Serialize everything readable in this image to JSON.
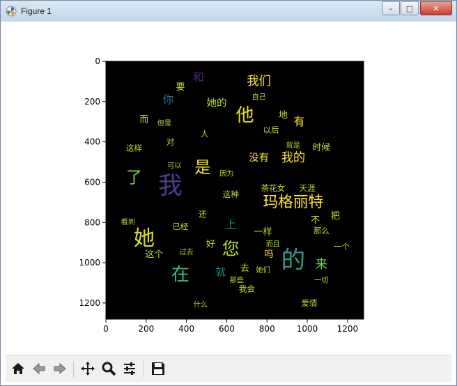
{
  "window": {
    "title": "Figure 1",
    "minimize_label": "–",
    "maximize_label": "□",
    "close_label": "✕"
  },
  "toolbar": {
    "icons": [
      "home-icon",
      "back-icon",
      "forward-icon",
      "pan-icon",
      "zoom-icon",
      "configure-subplots-icon",
      "save-icon"
    ]
  },
  "colors": {
    "plot_bg": "#000000",
    "axis": "#000000"
  },
  "chart_data": {
    "type": "image",
    "description_free": true,
    "xlim": [
      0,
      1280
    ],
    "ylim": [
      1280,
      0
    ],
    "xticks": [
      0,
      200,
      400,
      600,
      800,
      1000,
      1200
    ],
    "yticks": [
      0,
      200,
      400,
      600,
      800,
      1000,
      1200
    ],
    "xtick_labels": [
      "0",
      "200",
      "400",
      "600",
      "800",
      "1000",
      "1200"
    ],
    "ytick_labels": [
      "0",
      "200",
      "400",
      "600",
      "800",
      "1000",
      "1200"
    ],
    "words": [
      {
        "text": "我",
        "x": 320,
        "y": 620,
        "size": 120,
        "color": "#4b3d8f"
      },
      {
        "text": "的",
        "x": 930,
        "y": 990,
        "size": 120,
        "color": "#2a9c8a"
      },
      {
        "text": "她",
        "x": 190,
        "y": 880,
        "size": 105,
        "color": "#d8e219"
      },
      {
        "text": "他",
        "x": 690,
        "y": 270,
        "size": 90,
        "color": "#e5e419"
      },
      {
        "text": "在",
        "x": 370,
        "y": 1060,
        "size": 90,
        "color": "#3fbc73"
      },
      {
        "text": "您",
        "x": 620,
        "y": 930,
        "size": 85,
        "color": "#b5de2b"
      },
      {
        "text": "是",
        "x": 480,
        "y": 530,
        "size": 80,
        "color": "#fde725"
      },
      {
        "text": "了",
        "x": 140,
        "y": 580,
        "size": 80,
        "color": "#7ad151"
      },
      {
        "text": "玛格丽特",
        "x": 930,
        "y": 700,
        "size": 75,
        "color": "#fde725"
      },
      {
        "text": "我们",
        "x": 760,
        "y": 100,
        "size": 60,
        "color": "#fde725"
      },
      {
        "text": "我的",
        "x": 930,
        "y": 480,
        "size": 60,
        "color": "#fde725"
      },
      {
        "text": "来",
        "x": 1070,
        "y": 1010,
        "size": 60,
        "color": "#6ccd5a"
      },
      {
        "text": "和",
        "x": 460,
        "y": 80,
        "size": 55,
        "color": "#482878"
      },
      {
        "text": "没有",
        "x": 760,
        "y": 480,
        "size": 50,
        "color": "#fde725"
      },
      {
        "text": "你",
        "x": 310,
        "y": 190,
        "size": 55,
        "color": "#31688e"
      },
      {
        "text": "她的",
        "x": 550,
        "y": 210,
        "size": 50,
        "color": "#b5de2b"
      },
      {
        "text": "上",
        "x": 620,
        "y": 810,
        "size": 55,
        "color": "#26828e"
      },
      {
        "text": "有",
        "x": 960,
        "y": 300,
        "size": 55,
        "color": "#fde725"
      },
      {
        "text": "一样",
        "x": 780,
        "y": 850,
        "size": 45,
        "color": "#b5de2b"
      },
      {
        "text": "就",
        "x": 570,
        "y": 1050,
        "size": 50,
        "color": "#21918c"
      },
      {
        "text": "一个",
        "x": 1170,
        "y": 920,
        "size": 40,
        "color": "#b5de2b"
      },
      {
        "text": "时候",
        "x": 1070,
        "y": 430,
        "size": 45,
        "color": "#b5de2b"
      },
      {
        "text": "要",
        "x": 370,
        "y": 130,
        "size": 45,
        "color": "#b5de2b"
      },
      {
        "text": "这个",
        "x": 240,
        "y": 960,
        "size": 45,
        "color": "#b5de2b"
      },
      {
        "text": "这样",
        "x": 140,
        "y": 430,
        "size": 40,
        "color": "#b5de2b"
      },
      {
        "text": "茶花女",
        "x": 830,
        "y": 630,
        "size": 40,
        "color": "#b5de2b"
      },
      {
        "text": "已经",
        "x": 370,
        "y": 820,
        "size": 40,
        "color": "#b5de2b"
      },
      {
        "text": "以后",
        "x": 820,
        "y": 340,
        "size": 40,
        "color": "#b5de2b"
      },
      {
        "text": "吗",
        "x": 810,
        "y": 960,
        "size": 45,
        "color": "#fde725"
      },
      {
        "text": "去",
        "x": 690,
        "y": 1030,
        "size": 45,
        "color": "#b5de2b"
      },
      {
        "text": "地",
        "x": 880,
        "y": 270,
        "size": 45,
        "color": "#b5de2b"
      },
      {
        "text": "天涯",
        "x": 1000,
        "y": 630,
        "size": 40,
        "color": "#b5de2b"
      },
      {
        "text": "这种",
        "x": 620,
        "y": 660,
        "size": 40,
        "color": "#b5de2b"
      },
      {
        "text": "好",
        "x": 520,
        "y": 910,
        "size": 45,
        "color": "#b5de2b"
      },
      {
        "text": "而",
        "x": 190,
        "y": 290,
        "size": 45,
        "color": "#b5de2b"
      },
      {
        "text": "还",
        "x": 480,
        "y": 760,
        "size": 40,
        "color": "#b5de2b"
      },
      {
        "text": "什么",
        "x": 470,
        "y": 1210,
        "size": 35,
        "color": "#b5de2b"
      },
      {
        "text": "爱情",
        "x": 1010,
        "y": 1200,
        "size": 40,
        "color": "#b5de2b"
      },
      {
        "text": "她们",
        "x": 780,
        "y": 1040,
        "size": 35,
        "color": "#b5de2b"
      },
      {
        "text": "一切",
        "x": 1070,
        "y": 1090,
        "size": 35,
        "color": "#b5de2b"
      },
      {
        "text": "我会",
        "x": 700,
        "y": 1130,
        "size": 40,
        "color": "#b5de2b"
      },
      {
        "text": "那些",
        "x": 650,
        "y": 1090,
        "size": 35,
        "color": "#b5de2b"
      },
      {
        "text": "把",
        "x": 1140,
        "y": 770,
        "size": 45,
        "color": "#b5de2b"
      },
      {
        "text": "看到",
        "x": 110,
        "y": 800,
        "size": 35,
        "color": "#b5de2b"
      },
      {
        "text": "可以",
        "x": 340,
        "y": 520,
        "size": 35,
        "color": "#b5de2b"
      },
      {
        "text": "因为",
        "x": 600,
        "y": 560,
        "size": 35,
        "color": "#b5de2b"
      },
      {
        "text": "对",
        "x": 320,
        "y": 400,
        "size": 40,
        "color": "#b5de2b"
      },
      {
        "text": "不",
        "x": 1040,
        "y": 790,
        "size": 45,
        "color": "#b5de2b"
      },
      {
        "text": "那么",
        "x": 1070,
        "y": 840,
        "size": 40,
        "color": "#b5de2b"
      },
      {
        "text": "过去",
        "x": 400,
        "y": 950,
        "size": 35,
        "color": "#b5de2b"
      },
      {
        "text": "但是",
        "x": 290,
        "y": 310,
        "size": 35,
        "color": "#b5de2b"
      },
      {
        "text": "就是",
        "x": 930,
        "y": 420,
        "size": 35,
        "color": "#b5de2b"
      },
      {
        "text": "自己",
        "x": 760,
        "y": 180,
        "size": 35,
        "color": "#b5de2b"
      },
      {
        "text": "人",
        "x": 490,
        "y": 360,
        "size": 40,
        "color": "#b5de2b"
      },
      {
        "text": "而且",
        "x": 830,
        "y": 910,
        "size": 35,
        "color": "#b5de2b"
      }
    ]
  }
}
